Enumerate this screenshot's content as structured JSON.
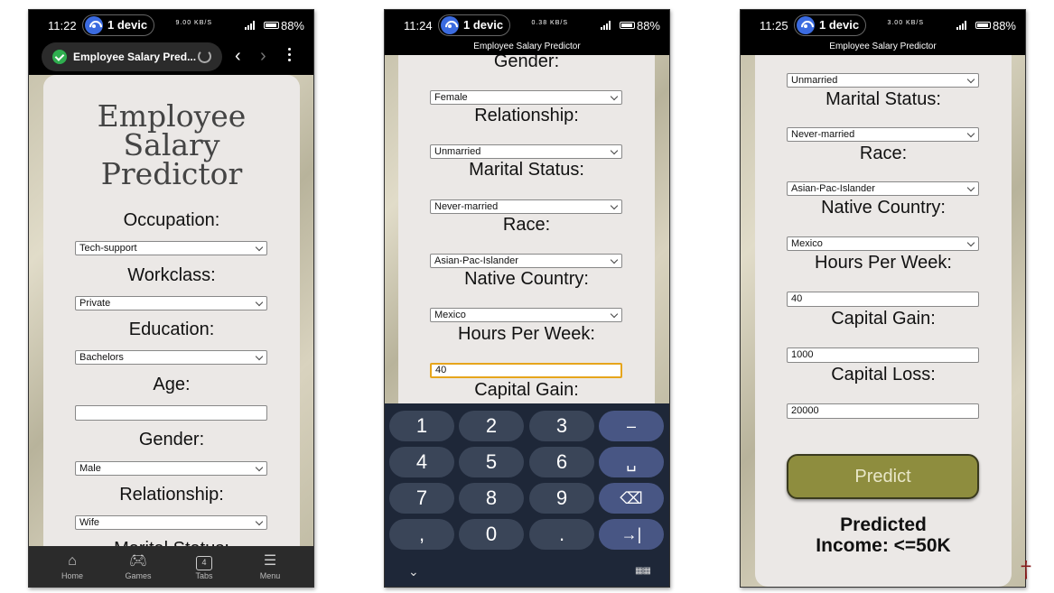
{
  "colors": {
    "card_bg": "#ebe8e6",
    "predict_button": "#8e8d3e",
    "focus_ring": "#e6a51c",
    "keyboard_bg": "#1e2738",
    "accent_key": "#485684"
  },
  "screens": [
    {
      "status": {
        "time": "11:22",
        "device": "1 devic",
        "battery": "88%",
        "net": "9.00 KB/S"
      },
      "browser": {
        "url_title": "Employee Salary Pred..."
      },
      "app_title": [
        "Employee",
        "Salary",
        "Predictor"
      ],
      "fields": [
        {
          "label": "Occupation:",
          "value": "Tech-support"
        },
        {
          "label": "Workclass:",
          "value": "Private"
        },
        {
          "label": "Education:",
          "value": "Bachelors"
        },
        {
          "label": "Age:",
          "value": ""
        },
        {
          "label": "Gender:",
          "value": "Male"
        },
        {
          "label": "Relationship:",
          "value": "Wife"
        },
        {
          "label": "Marital Status:",
          "value": ""
        }
      ],
      "bottom_nav": [
        {
          "label": "Home",
          "icon": "home-icon"
        },
        {
          "label": "Games",
          "icon": "gamepad-icon"
        },
        {
          "label": "Tabs",
          "icon": "tabs-icon",
          "count": "4"
        },
        {
          "label": "Menu",
          "icon": "menu-icon"
        }
      ]
    },
    {
      "status": {
        "time": "11:24",
        "device": "1 devic",
        "battery": "88%",
        "net": "0.38 KB/S"
      },
      "browser": {
        "page_title": "Employee Salary Predictor"
      },
      "fields": [
        {
          "label": "Gender:",
          "value": "Female"
        },
        {
          "label": "Relationship:",
          "value": "Unmarried"
        },
        {
          "label": "Marital Status:",
          "value": "Never-married"
        },
        {
          "label": "Race:",
          "value": "Asian-Pac-Islander"
        },
        {
          "label": "Native Country:",
          "value": "Mexico"
        },
        {
          "label": "Hours Per Week:",
          "value": "40"
        },
        {
          "label": "Capital Gain:",
          "value": ""
        }
      ],
      "keyboard": {
        "keys": [
          "1",
          "2",
          "3",
          "–",
          "4",
          "5",
          "6",
          "␣",
          "7",
          "8",
          "9",
          "⌫",
          ",",
          "0",
          ".",
          "→|"
        ]
      }
    },
    {
      "status": {
        "time": "11:25",
        "device": "1 devic",
        "battery": "88%",
        "net": "3.00 KB/S"
      },
      "browser": {
        "page_title": "Employee Salary Predictor"
      },
      "top_value": "Unmarried",
      "fields": [
        {
          "label": "Marital Status:",
          "value": "Never-married"
        },
        {
          "label": "Race:",
          "value": "Asian-Pac-Islander"
        },
        {
          "label": "Native Country:",
          "value": "Mexico"
        },
        {
          "label": "Hours Per Week:",
          "value": "40"
        },
        {
          "label": "Capital Gain:",
          "value": "1000"
        },
        {
          "label": "Capital Loss:",
          "value": "20000"
        }
      ],
      "predict_label": "Predict",
      "result": [
        "Predicted",
        "Income: <=50K"
      ]
    }
  ]
}
